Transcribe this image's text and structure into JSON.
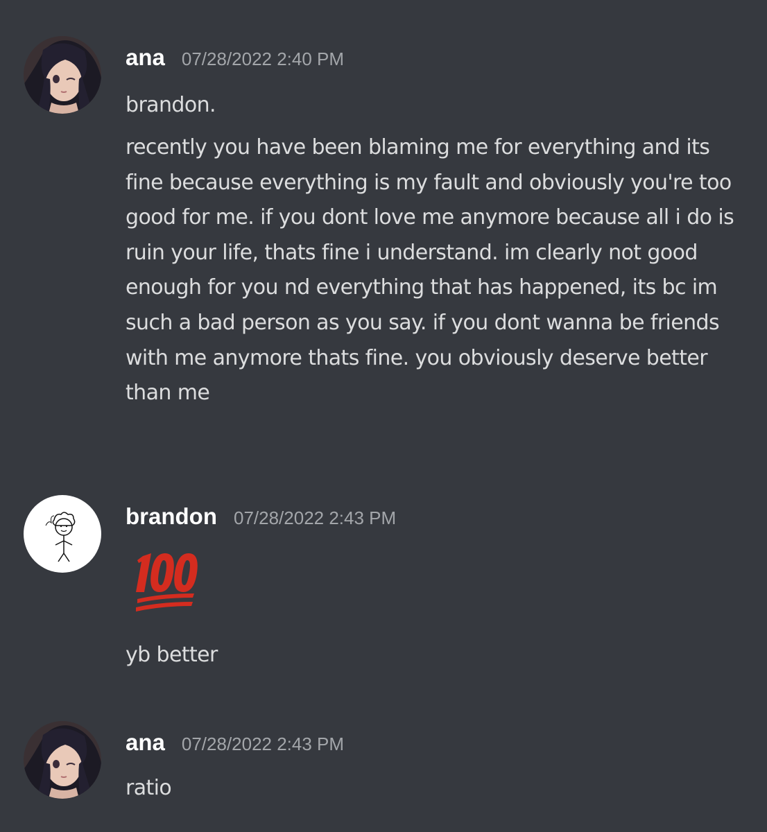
{
  "messages": [
    {
      "author": "ana",
      "timestamp": "07/28/2022 2:40 PM",
      "lines": [
        "brandon.",
        "recently you have been blaming me for everything and its fine because everything is my fault and obviously you're too good for me. if you dont love me anymore because all i do is ruin your life, thats fine i understand. im clearly not good enough for you nd everything that has happened, its bc im such a bad person as you say. if you dont wanna be friends with me anymore thats fine. you obviously deserve better than me"
      ]
    },
    {
      "author": "brandon",
      "timestamp": "07/28/2022 2:43 PM",
      "emoji": "hundred-points",
      "lines": [
        "yb better"
      ]
    },
    {
      "author": "ana",
      "timestamp": "07/28/2022 2:43 PM",
      "lines": [
        "ratio"
      ]
    }
  ],
  "colors": {
    "background": "#36393f",
    "username": "#ffffff",
    "timestamp": "#a3a6aa",
    "message_text": "#dcddde",
    "emoji_red": "#d42c1f"
  }
}
